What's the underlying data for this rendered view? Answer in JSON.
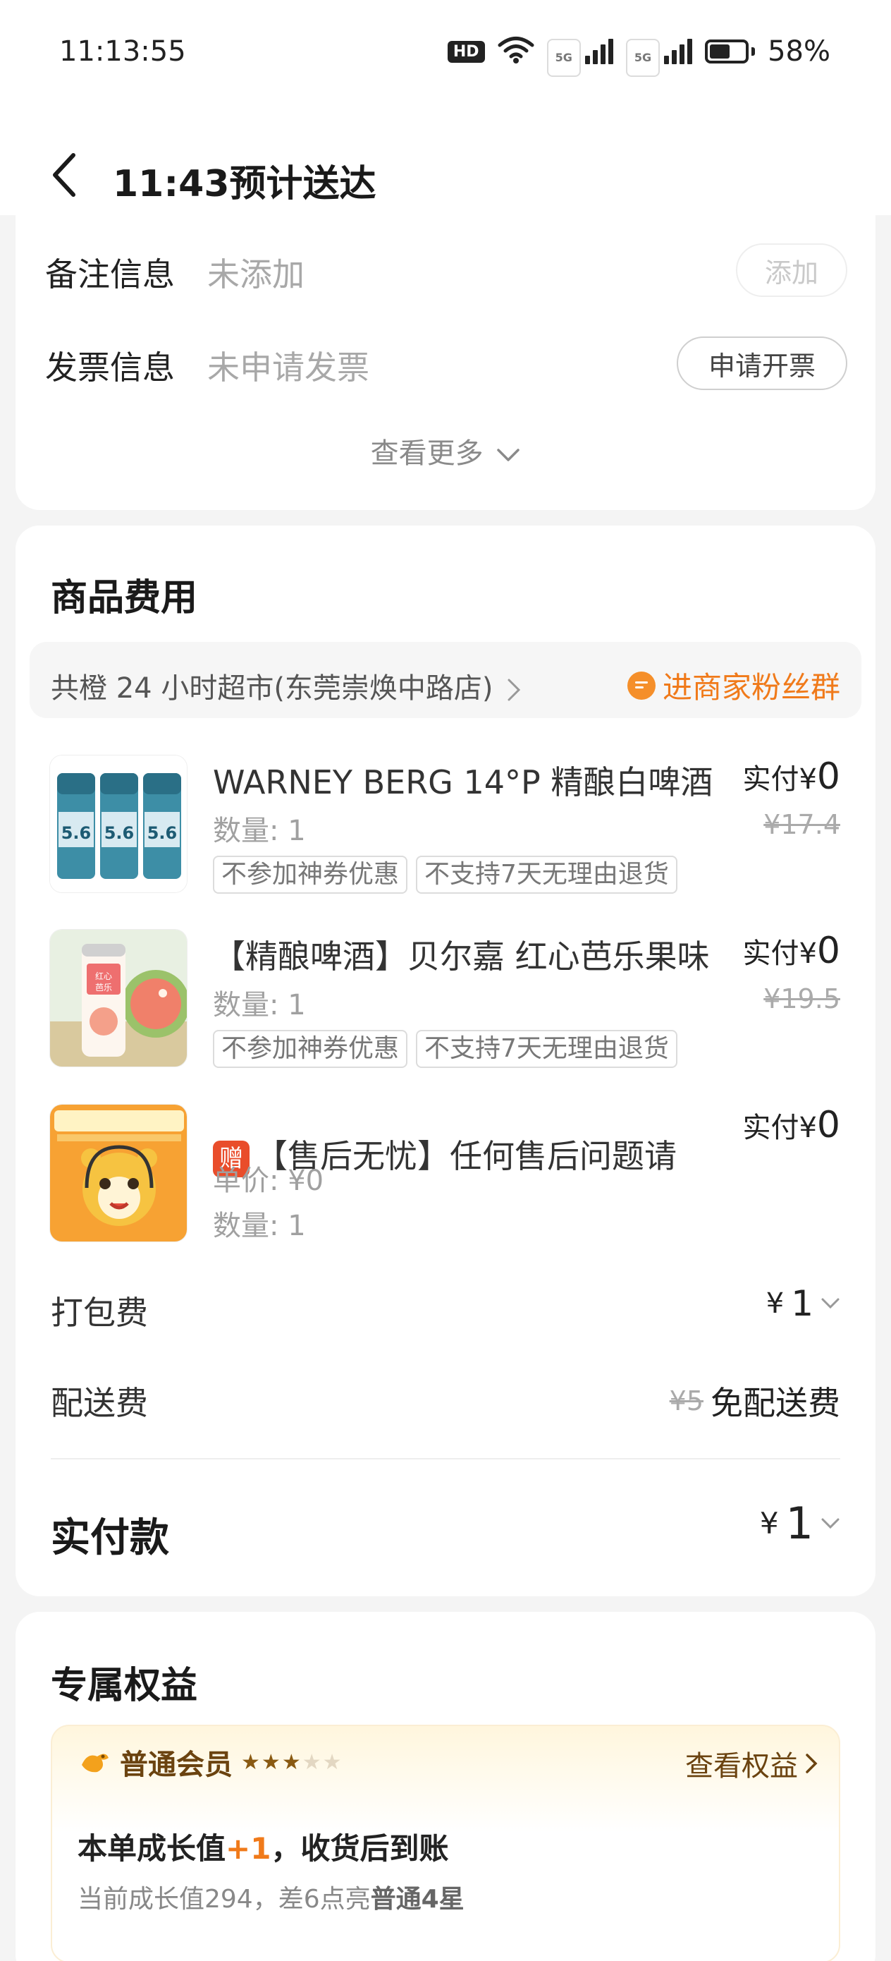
{
  "status_bar": {
    "time": "11:13:55",
    "hd": "HD",
    "signal_1": "5G",
    "signal_2": "5G",
    "battery": "58%"
  },
  "header": {
    "title": "11:43预计送达"
  },
  "info": {
    "remark_label": "备注信息",
    "remark_value": "未添加",
    "remark_button": "添加",
    "invoice_label": "发票信息",
    "invoice_value": "未申请发票",
    "invoice_button": "申请开票",
    "see_more": "查看更多"
  },
  "goods": {
    "section_title": "商品费用",
    "shop_name": "共橙 24 小时超市(东莞崇焕中路店)",
    "fans_group": "进商家粉丝群",
    "items": [
      {
        "name": "WARNEY BERG 14°P 精酿白啤酒",
        "qty": "数量: 1",
        "tags": [
          "不参加神券优惠",
          "不支持7天无理由退货"
        ],
        "paid_label": "实付",
        "currency": "¥",
        "paid": "0",
        "original": "¥17.4"
      },
      {
        "name": "【精酿啤酒】贝尔嘉 红心芭乐果味",
        "qty": "数量: 1",
        "tags": [
          "不参加神券优惠",
          "不支持7天无理由退货"
        ],
        "paid_label": "实付",
        "currency": "¥",
        "paid": "0",
        "original": "¥19.5"
      },
      {
        "gift_badge": "赠",
        "name": "【售后无忧】任何售后问题请",
        "unit_price": "单价: ¥0",
        "qty": "数量: 1",
        "paid_label": "实付",
        "currency": "¥",
        "paid": "0"
      }
    ],
    "packing_label": "打包费",
    "packing_currency": "¥",
    "packing_value": "1",
    "delivery_label": "配送费",
    "delivery_original": "¥5",
    "delivery_value": "免配送费",
    "total_label": "实付款",
    "total_currency": "¥",
    "total_value": "1"
  },
  "benefits": {
    "section_title": "专属权益",
    "member_level": "普通会员",
    "stars_total": 5,
    "stars_filled": 3,
    "view_link": "查看权益",
    "growth_prefix": "本单成长值",
    "growth_plus": "+1",
    "growth_suffix": "，收货后到账",
    "current_prefix": "当前成长值294，差6点亮",
    "current_target": "普通4星"
  },
  "colors": {
    "accent_orange": "#f07a1a",
    "gift_red": "#e94d2b",
    "star_gold": "#8a5a12"
  }
}
